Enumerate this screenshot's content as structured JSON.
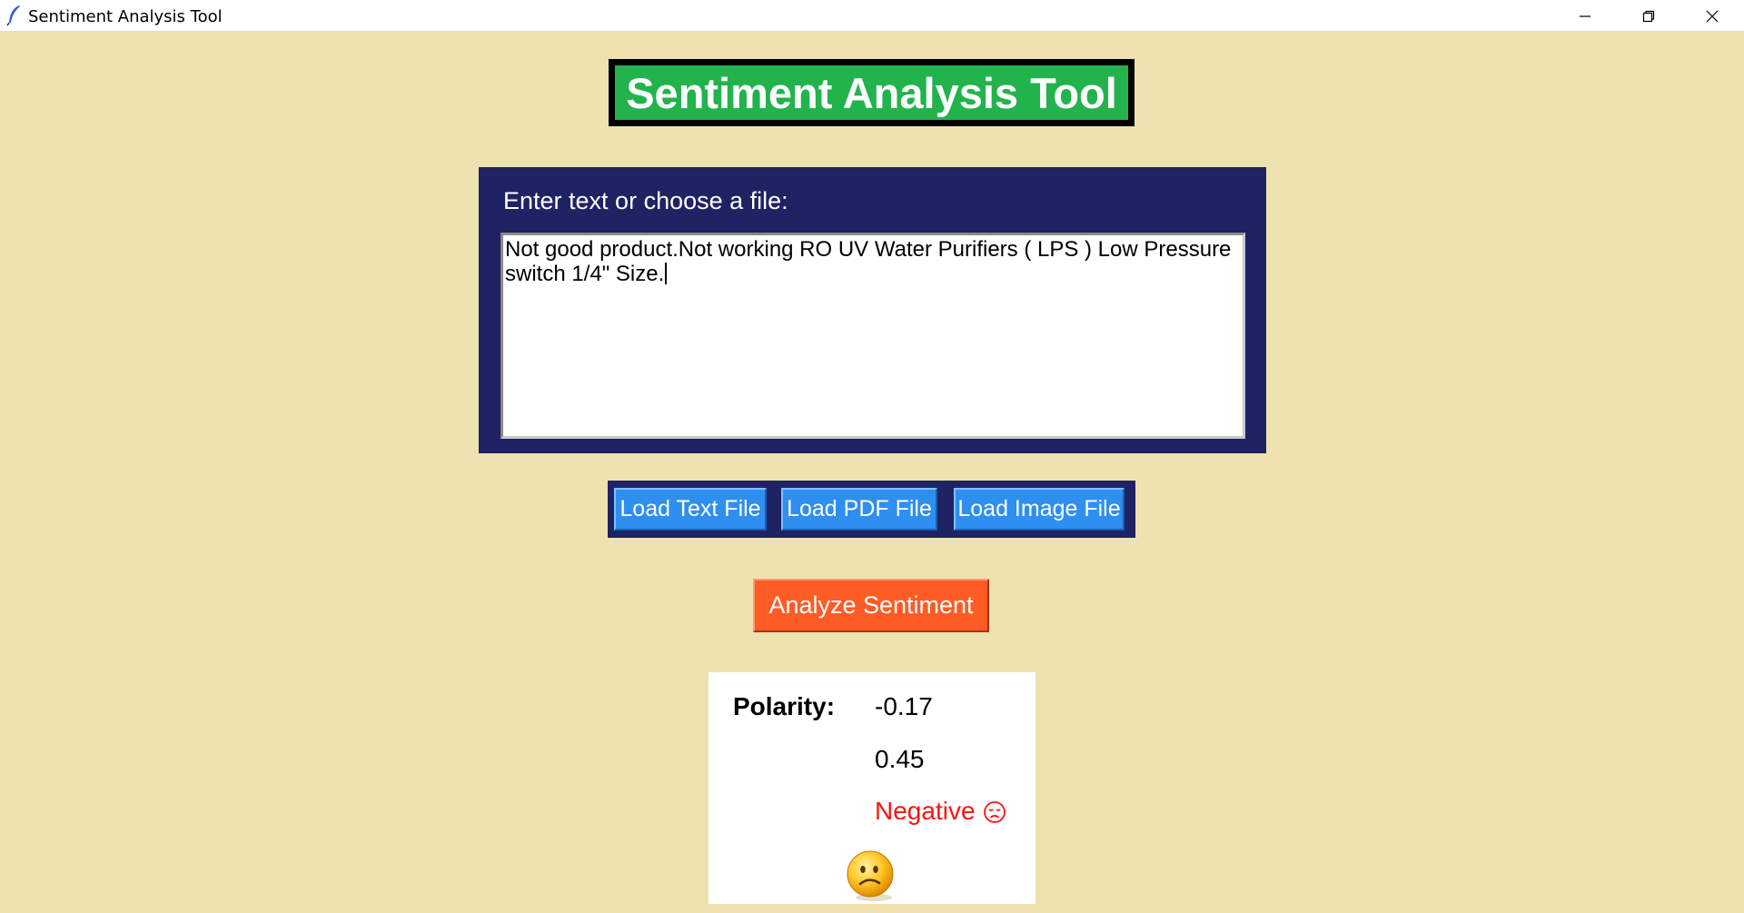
{
  "window": {
    "title": "Sentiment Analysis Tool",
    "controls": [
      "minimize-icon",
      "restore-icon",
      "close-icon"
    ]
  },
  "app": {
    "heading": "Sentiment Analysis Tool"
  },
  "input": {
    "label": "Enter text or choose a file:",
    "value": "Not good product.Not working RO UV Water Purifiers ( LPS ) Low Pressure switch 1/4\" Size."
  },
  "file_buttons": {
    "load_text": "Load Text File",
    "load_pdf": "Load PDF File",
    "load_image": "Load Image File"
  },
  "analyze": {
    "label": "Analyze Sentiment"
  },
  "results": {
    "polarity_label": "Polarity:",
    "polarity_value": "-0.17",
    "subjectivity_value": "0.45",
    "sentiment": "Negative",
    "sentiment_icon": "sad-face-icon",
    "result_emoji": "frowning-face-icon"
  },
  "colors": {
    "background": "#eee2b0",
    "heading_bg": "#22b34c",
    "panel_bg": "#1f2263",
    "load_button": "#2e8ff0",
    "analyze_button": "#ff5b24",
    "negative_text": "#ff1111"
  }
}
